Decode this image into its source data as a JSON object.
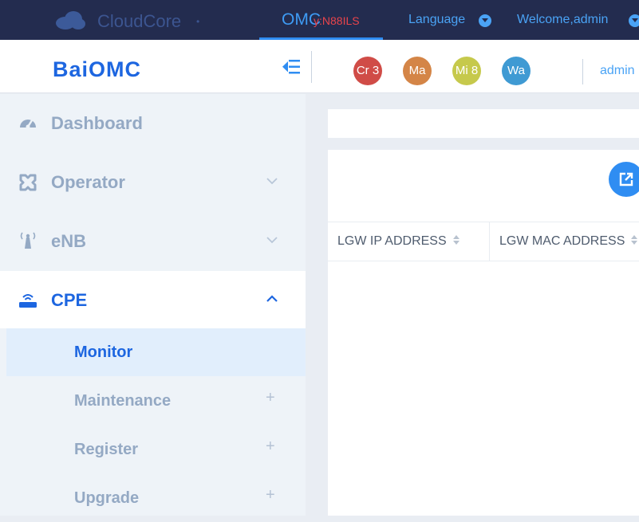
{
  "topbar": {
    "brand": "CloudCore",
    "brand_dot": "•",
    "omc_label": "OMC",
    "omc_sub": "y:N88ILS",
    "language": "Language",
    "welcome": "Welcome,admin"
  },
  "subbar": {
    "logo": "BaiOMC",
    "badges": [
      {
        "label": "Cr 3",
        "color": "#d04c47"
      },
      {
        "label": "Ma",
        "color": "#d48547"
      },
      {
        "label": "Mi 8",
        "color": "#c6c94c"
      },
      {
        "label": "Wa",
        "color": "#3f9ad3"
      }
    ],
    "user": "admin"
  },
  "sidebar": {
    "items": [
      {
        "label": "Dashboard",
        "icon": "dashboard-icon"
      },
      {
        "label": "Operator",
        "icon": "operator-icon"
      },
      {
        "label": "eNB",
        "icon": "antenna-icon"
      },
      {
        "label": "CPE",
        "icon": "router-icon"
      }
    ],
    "cpe_children": [
      {
        "label": "Monitor"
      },
      {
        "label": "Maintenance",
        "plus": "+"
      },
      {
        "label": "Register",
        "plus": "+"
      },
      {
        "label": "Upgrade",
        "plus": "+"
      }
    ]
  },
  "table": {
    "columns": [
      "LGW IP ADDRESS",
      "LGW MAC ADDRESS"
    ]
  },
  "colors": {
    "accent": "#2f8df2",
    "topbar_bg": "#232c4f",
    "logo": "#1d66e0"
  }
}
